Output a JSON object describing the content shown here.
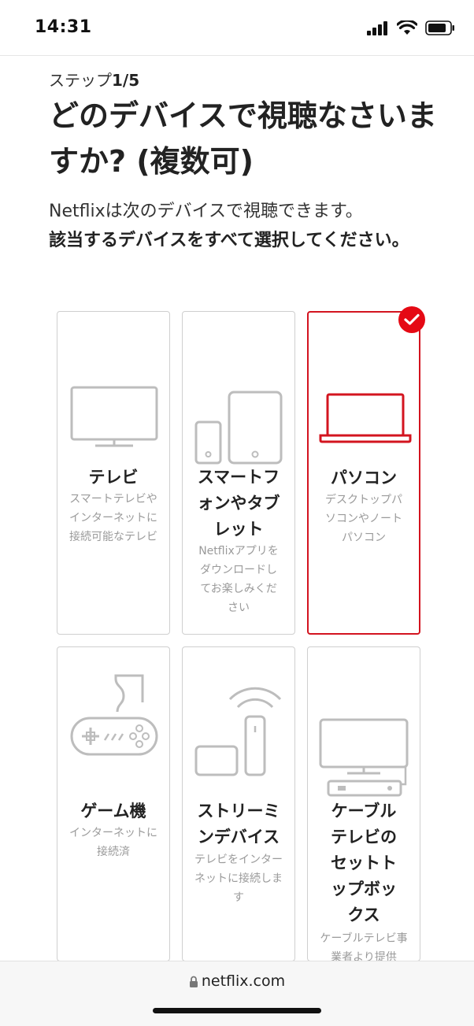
{
  "status": {
    "time": "14:31"
  },
  "step": {
    "prefix": "ステップ",
    "number": "1/5"
  },
  "title": "どのデバイスで視聴なさいますか? (複数可)",
  "intro": {
    "line": "Netflixは次のデバイスで視聴できます。",
    "strong": "該当するデバイスをすべて選択してください。"
  },
  "devices": [
    {
      "title": "テレビ",
      "desc": "スマートテレビやインターネットに接続可能なテレビ",
      "selected": false,
      "icon": "tv-icon"
    },
    {
      "title": "スマートフォンやタブレット",
      "desc": "Netflixアプリをダウンロードしてお楽しみください",
      "selected": false,
      "icon": "phone-tablet-icon"
    },
    {
      "title": "パソコン",
      "desc": "デスクトップパソコンやノートパソコン",
      "selected": true,
      "icon": "laptop-icon"
    },
    {
      "title": "ゲーム機",
      "desc": "インターネットに接続済",
      "selected": false,
      "icon": "game-controller-icon"
    },
    {
      "title": "ストリーミンデバイス",
      "desc": "テレビをインターネットに接続します",
      "selected": false,
      "icon": "streaming-device-icon"
    },
    {
      "title": "ケーブルテレビのセットトップボックス",
      "desc": "ケーブルテレビ事業者より提供",
      "selected": false,
      "icon": "set-top-box-icon"
    }
  ],
  "url_bar": {
    "url": "netflix.com"
  },
  "colors": {
    "accent": "#e50914",
    "card_border": "#cfcfcf",
    "icon_gray": "#bdbdbd"
  }
}
